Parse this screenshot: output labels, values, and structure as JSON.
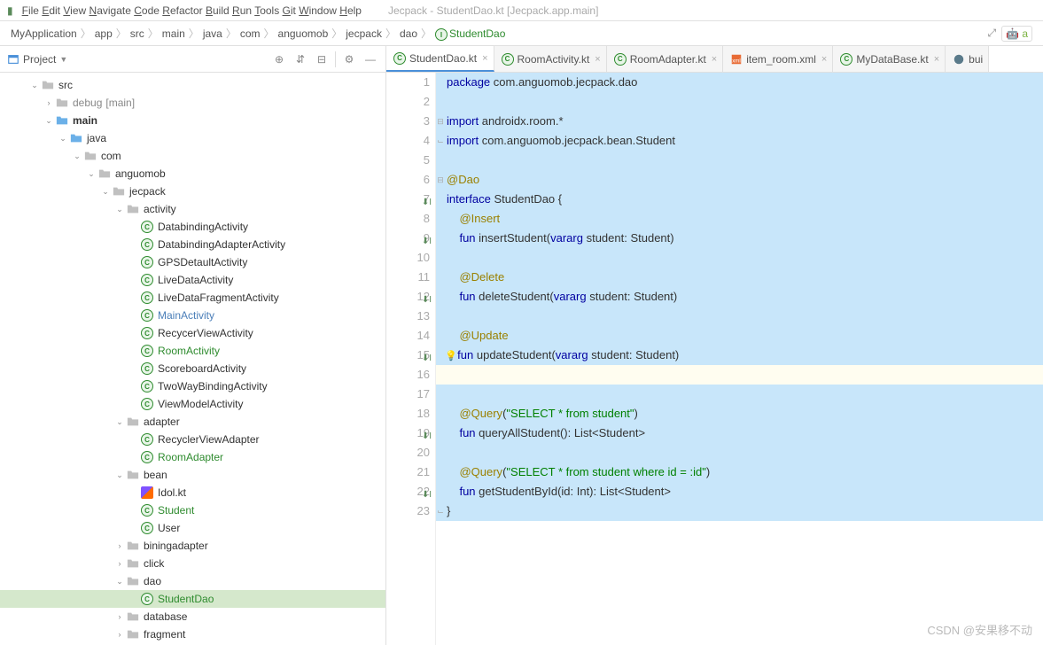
{
  "window_title": "Jecpack - StudentDao.kt [Jecpack.app.main]",
  "menu": [
    "File",
    "Edit",
    "View",
    "Navigate",
    "Code",
    "Refactor",
    "Build",
    "Run",
    "Tools",
    "Git",
    "Window",
    "Help"
  ],
  "breadcrumb": [
    "MyApplication",
    "app",
    "src",
    "main",
    "java",
    "com",
    "anguomob",
    "jecpack",
    "dao",
    "StudentDao"
  ],
  "project_tool": "Project",
  "tree": [
    {
      "d": 2,
      "exp": "v",
      "ic": "folder",
      "lbl": "src"
    },
    {
      "d": 3,
      "exp": ">",
      "ic": "folder",
      "lbl": "debug",
      "suf": "[main]",
      "cls": "gray"
    },
    {
      "d": 3,
      "exp": "v",
      "ic": "folder-blue",
      "lbl": "main",
      "bold": true
    },
    {
      "d": 4,
      "exp": "v",
      "ic": "folder-blue",
      "lbl": "java"
    },
    {
      "d": 5,
      "exp": "v",
      "ic": "folder",
      "lbl": "com"
    },
    {
      "d": 6,
      "exp": "v",
      "ic": "folder",
      "lbl": "anguomob"
    },
    {
      "d": 7,
      "exp": "v",
      "ic": "folder",
      "lbl": "jecpack"
    },
    {
      "d": 8,
      "exp": "v",
      "ic": "folder",
      "lbl": "activity"
    },
    {
      "d": 9,
      "ic": "class",
      "lbl": "DatabindingActivity"
    },
    {
      "d": 9,
      "ic": "class",
      "lbl": "DatabindingAdapterActivity"
    },
    {
      "d": 9,
      "ic": "class",
      "lbl": "GPSDetaultActivity"
    },
    {
      "d": 9,
      "ic": "class",
      "lbl": "LiveDataActivity"
    },
    {
      "d": 9,
      "ic": "class",
      "lbl": "LiveDataFragmentActivity"
    },
    {
      "d": 9,
      "ic": "class",
      "lbl": "MainActivity",
      "cls": "blue"
    },
    {
      "d": 9,
      "ic": "class",
      "lbl": "RecycerViewActivity"
    },
    {
      "d": 9,
      "ic": "class",
      "lbl": "RoomActivity",
      "cls": "green"
    },
    {
      "d": 9,
      "ic": "class",
      "lbl": "ScoreboardActivity"
    },
    {
      "d": 9,
      "ic": "class",
      "lbl": "TwoWayBindingActivity"
    },
    {
      "d": 9,
      "ic": "class",
      "lbl": "ViewModelActivity"
    },
    {
      "d": 8,
      "exp": "v",
      "ic": "folder",
      "lbl": "adapter"
    },
    {
      "d": 9,
      "ic": "class",
      "lbl": "RecyclerViewAdapter"
    },
    {
      "d": 9,
      "ic": "class",
      "lbl": "RoomAdapter",
      "cls": "green"
    },
    {
      "d": 8,
      "exp": "v",
      "ic": "folder",
      "lbl": "bean"
    },
    {
      "d": 9,
      "ic": "kt",
      "lbl": "Idol.kt"
    },
    {
      "d": 9,
      "ic": "class",
      "lbl": "Student",
      "cls": "green"
    },
    {
      "d": 9,
      "ic": "class",
      "lbl": "User"
    },
    {
      "d": 8,
      "exp": ">",
      "ic": "folder",
      "lbl": "biningadapter"
    },
    {
      "d": 8,
      "exp": ">",
      "ic": "folder",
      "lbl": "click"
    },
    {
      "d": 8,
      "exp": "v",
      "ic": "folder",
      "lbl": "dao"
    },
    {
      "d": 9,
      "ic": "class",
      "lbl": "StudentDao",
      "cls": "green",
      "sel": true
    },
    {
      "d": 8,
      "exp": ">",
      "ic": "folder",
      "lbl": "database"
    },
    {
      "d": 8,
      "exp": ">",
      "ic": "folder",
      "lbl": "fragment"
    }
  ],
  "tabs": [
    {
      "name": "StudentDao.kt",
      "ic": "class",
      "active": true
    },
    {
      "name": "RoomActivity.kt",
      "ic": "class"
    },
    {
      "name": "RoomAdapter.kt",
      "ic": "class"
    },
    {
      "name": "item_room.xml",
      "ic": "xml"
    },
    {
      "name": "MyDataBase.kt",
      "ic": "class"
    },
    {
      "name": "bui",
      "ic": "gradle",
      "noclose": true
    }
  ],
  "code": {
    "lines": [
      {
        "n": 1,
        "h": "<span class='kw'>package</span> <span class='pkg'>com.anguomob.jecpack.dao</span>",
        "sel": true
      },
      {
        "n": 2,
        "h": "",
        "sel": true
      },
      {
        "n": 3,
        "h": "<span class='kw'>import</span> <span class='pkg'>androidx.room.*</span>",
        "sel": true,
        "fold": "-"
      },
      {
        "n": 4,
        "h": "<span class='kw'>import</span> <span class='pkg'>com.anguomob.jecpack.bean.Student</span>",
        "sel": true,
        "foldend": true
      },
      {
        "n": 5,
        "h": "",
        "sel": true
      },
      {
        "n": 6,
        "h": "<span class='ann'>@Dao</span>",
        "sel": true,
        "fold": "-"
      },
      {
        "n": 7,
        "h": "<span class='kw'>interface</span> <span class='id'>StudentDao</span> {",
        "sel": true,
        "mark": "impl"
      },
      {
        "n": 8,
        "h": "    <span class='ann'>@Insert</span>",
        "sel": true
      },
      {
        "n": 9,
        "h": "    <span class='kw'>fun</span> <span class='fn'>insertStudent</span>(<span class='kw'>vararg</span> student: Student)",
        "sel": true,
        "mark": "impl"
      },
      {
        "n": 10,
        "h": "",
        "sel": true
      },
      {
        "n": 11,
        "h": "    <span class='ann'>@Delete</span>",
        "sel": true
      },
      {
        "n": 12,
        "h": "    <span class='kw'>fun</span> <span class='fn'>deleteStudent</span>(<span class='kw'>vararg</span> student: Student)",
        "sel": true,
        "mark": "impl"
      },
      {
        "n": 13,
        "h": "",
        "sel": true
      },
      {
        "n": 14,
        "h": "    <span class='ann'>@Update</span>",
        "sel": true
      },
      {
        "n": 15,
        "h": "    <span class='kw'>fun</span> <span class='fn'>updateStudent</span>(<span class='kw'>vararg</span> student: Student)",
        "sel": true,
        "mark": "impl",
        "bulb": true
      },
      {
        "n": 16,
        "h": "",
        "cur": true
      },
      {
        "n": 17,
        "h": "",
        "sel": true
      },
      {
        "n": 18,
        "h": "    <span class='ann'>@Query</span>(<span class='str'>\"SELECT * from student\"</span>)",
        "sel": true
      },
      {
        "n": 19,
        "h": "    <span class='kw'>fun</span> <span class='fn'>queryAllStudent</span>(): List&lt;Student&gt;",
        "sel": true,
        "mark": "impl"
      },
      {
        "n": 20,
        "h": "",
        "sel": true
      },
      {
        "n": 21,
        "h": "    <span class='ann'>@Query</span>(<span class='str'>\"SELECT * from student where id = :id\"</span>)",
        "sel": true
      },
      {
        "n": 22,
        "h": "    <span class='kw'>fun</span> <span class='fn'>getStudentById</span>(id: Int): List&lt;Student&gt;",
        "sel": true,
        "mark": "impl"
      },
      {
        "n": 23,
        "h": "}",
        "sel": true,
        "foldend": true
      }
    ]
  },
  "watermark": "CSDN @安果移不动"
}
